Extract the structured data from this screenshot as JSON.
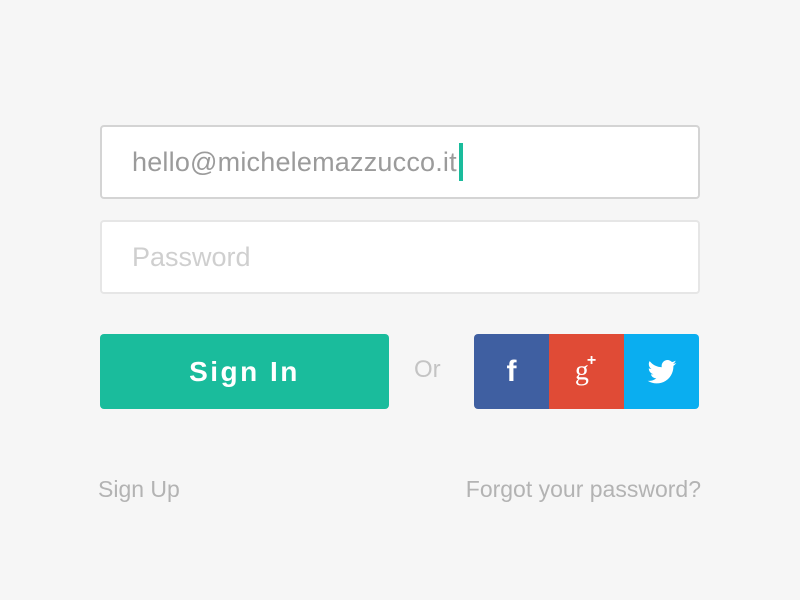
{
  "form": {
    "email_value": "hello@michelemazzucco.it",
    "password_placeholder": "Password",
    "signin_label": "Sign In",
    "or_label": "Or"
  },
  "social": {
    "facebook_glyph": "f",
    "google_glyph": "g",
    "google_plus": "+",
    "icons": [
      "facebook-icon",
      "google-plus-icon",
      "twitter-icon"
    ]
  },
  "links": {
    "signup": "Sign Up",
    "forgot": "Forgot your password?"
  },
  "colors": {
    "accent": "#1abc9c",
    "facebook": "#3f5fa1",
    "google": "#e04b36",
    "twitter": "#0aaef0",
    "background": "#f6f6f6"
  }
}
